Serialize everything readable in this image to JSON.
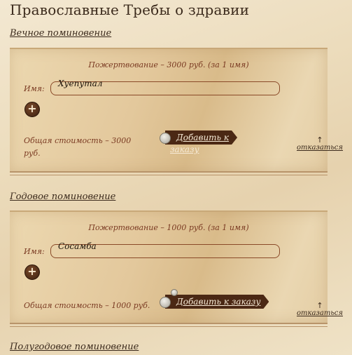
{
  "page": {
    "title": "Православные Требы о здравии"
  },
  "sections": [
    {
      "title": "Вечное поминовение",
      "donation": "Пожертвование – 3000 руб. (за 1 имя)",
      "name_label": "Имя:",
      "name_value": "Хуепутал",
      "add_symbol": "+",
      "total_line1": "Общая стоимость – 3000",
      "total_line2": "руб.",
      "order_line1": "Добавить к",
      "order_line2": "заказу",
      "refuse_arrow": "↑",
      "refuse": "отказаться"
    },
    {
      "title": "Годовое поминовение",
      "donation": "Пожертвование – 1000 руб. (за 1 имя)",
      "name_label": "Имя:",
      "name_value": "Сосамба",
      "add_symbol": "+",
      "total": "Общая стоимость – 1000 руб.",
      "order": "Добавить к заказу",
      "refuse_arrow": "↑",
      "refuse": "отказаться"
    },
    {
      "title": "Полугодовое поминовение"
    }
  ],
  "icons": {
    "add": "plus-icon",
    "refuse": "up-arrow-icon",
    "seal": "seal-icon"
  }
}
